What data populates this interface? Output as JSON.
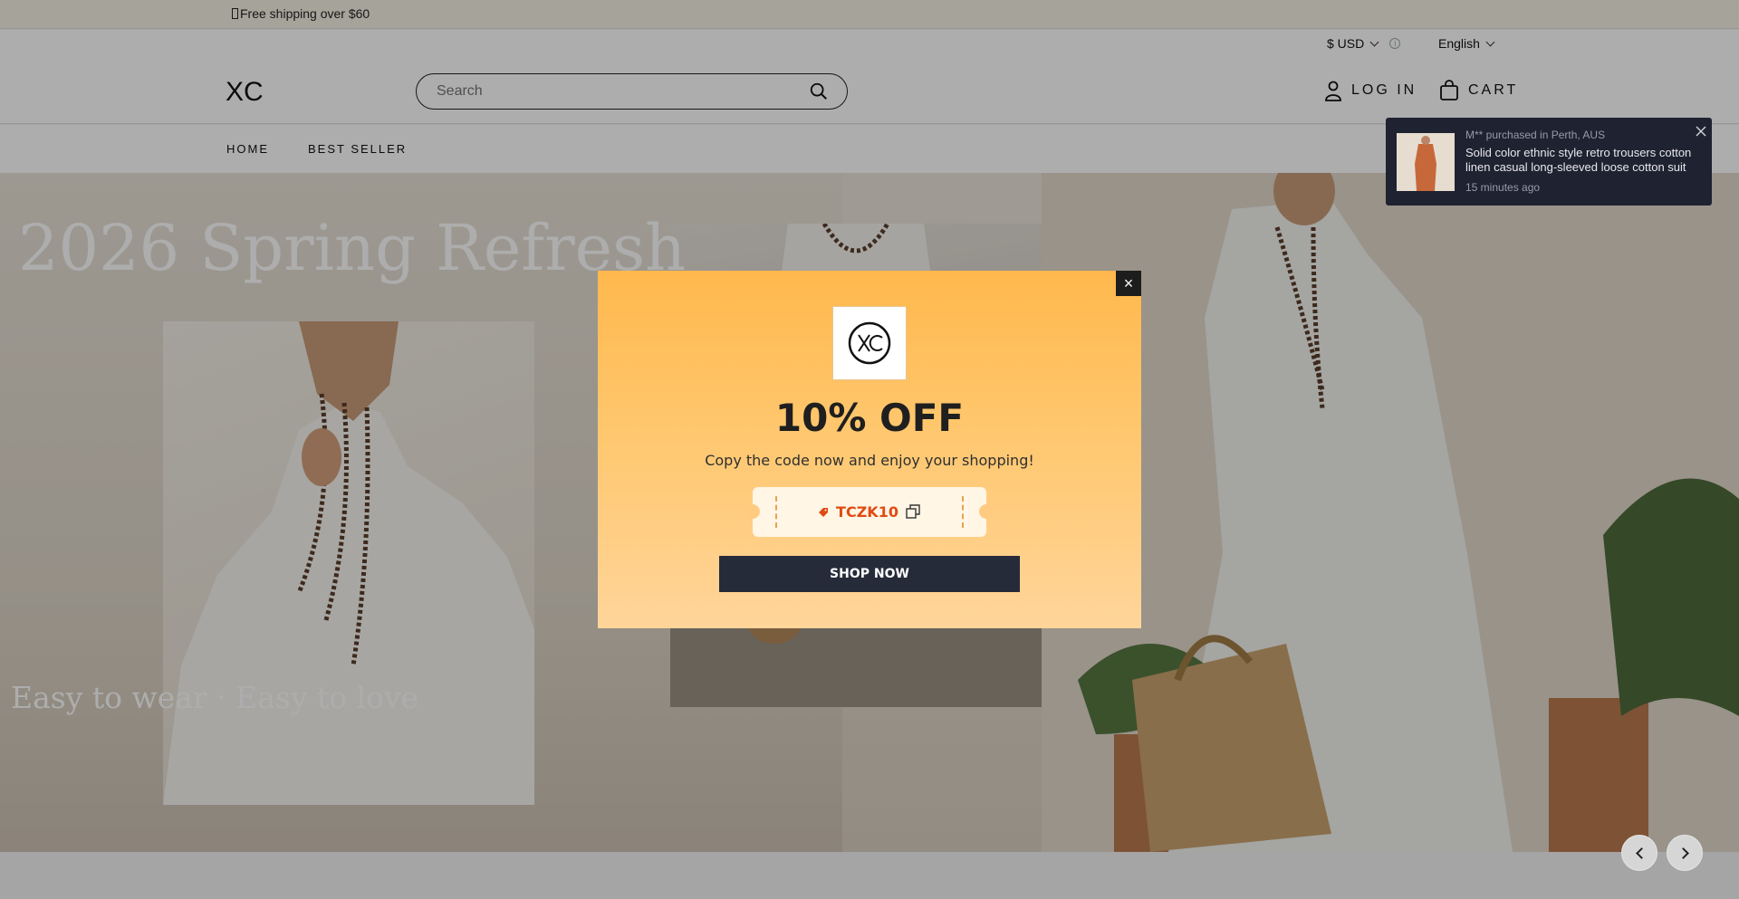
{
  "announcement": {
    "text": "Free shipping over $60"
  },
  "header": {
    "currency": "$ USD",
    "language": "English",
    "logo": "XC",
    "search_placeholder": "Search",
    "login_label": "LOG IN",
    "cart_label": "CART"
  },
  "nav": {
    "items": [
      {
        "label": "HOME"
      },
      {
        "label": "BEST SELLER"
      }
    ]
  },
  "hero": {
    "title": "2026 Spring Refresh",
    "subtitle": "Easy to wear · Easy to love"
  },
  "toast": {
    "meta": "M** purchased in Perth, AUS",
    "product": "Solid color ethnic style retro trousers cotton linen casual long-sleeved loose cotton suit",
    "time": "15 minutes ago"
  },
  "popup": {
    "close_label": "×",
    "heading": "10% OFF",
    "text": "Copy the code now and enjoy your shopping!",
    "code": "TCZK10",
    "button_label": "SHOP NOW",
    "colors": {
      "gradient_top": "#ffb84d",
      "gradient_bottom": "#ffd59a",
      "code_color": "#e04b14",
      "button_bg": "#262b39"
    }
  },
  "icons": [
    "search-icon",
    "user-icon",
    "bag-icon",
    "chevron-down-icon",
    "info-icon",
    "close-icon",
    "copy-icon",
    "tag-icon",
    "chevron-left-icon",
    "chevron-right-icon"
  ]
}
